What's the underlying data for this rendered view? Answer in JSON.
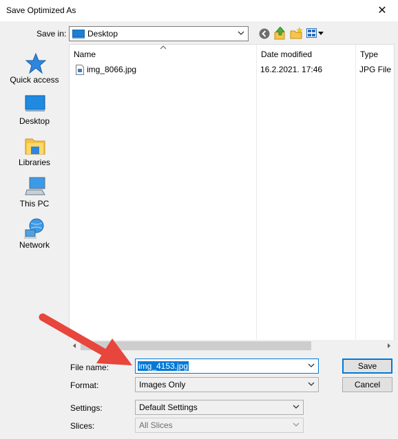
{
  "window": {
    "title": "Save Optimized As",
    "close_glyph": "✕"
  },
  "toolbar": {
    "save_in_label": "Save in:",
    "location_value": "Desktop",
    "icons": [
      "back-icon",
      "up-folder-icon",
      "new-folder-icon",
      "view-menu-icon"
    ]
  },
  "places": [
    {
      "label": "Quick access",
      "icon": "quick-access-star-icon"
    },
    {
      "label": "Desktop",
      "icon": "desktop-icon"
    },
    {
      "label": "Libraries",
      "icon": "libraries-icon"
    },
    {
      "label": "This PC",
      "icon": "this-pc-icon"
    },
    {
      "label": "Network",
      "icon": "network-icon"
    }
  ],
  "filelist": {
    "columns": [
      "Name",
      "Date modified",
      "Type"
    ],
    "rows": [
      {
        "name": "img_8066.jpg",
        "date": "16.2.2021. 17:46",
        "type": "JPG File"
      }
    ]
  },
  "form": {
    "file_name_label": "File name:",
    "file_name_value": "img_4153.jpg",
    "format_label": "Format:",
    "format_value": "Images Only",
    "settings_label": "Settings:",
    "settings_value": "Default Settings",
    "slices_label": "Slices:",
    "slices_value": "All Slices"
  },
  "buttons": {
    "save": "Save",
    "cancel": "Cancel"
  },
  "colors": {
    "accent": "#0078d7",
    "annotation_arrow": "#e8453c"
  }
}
